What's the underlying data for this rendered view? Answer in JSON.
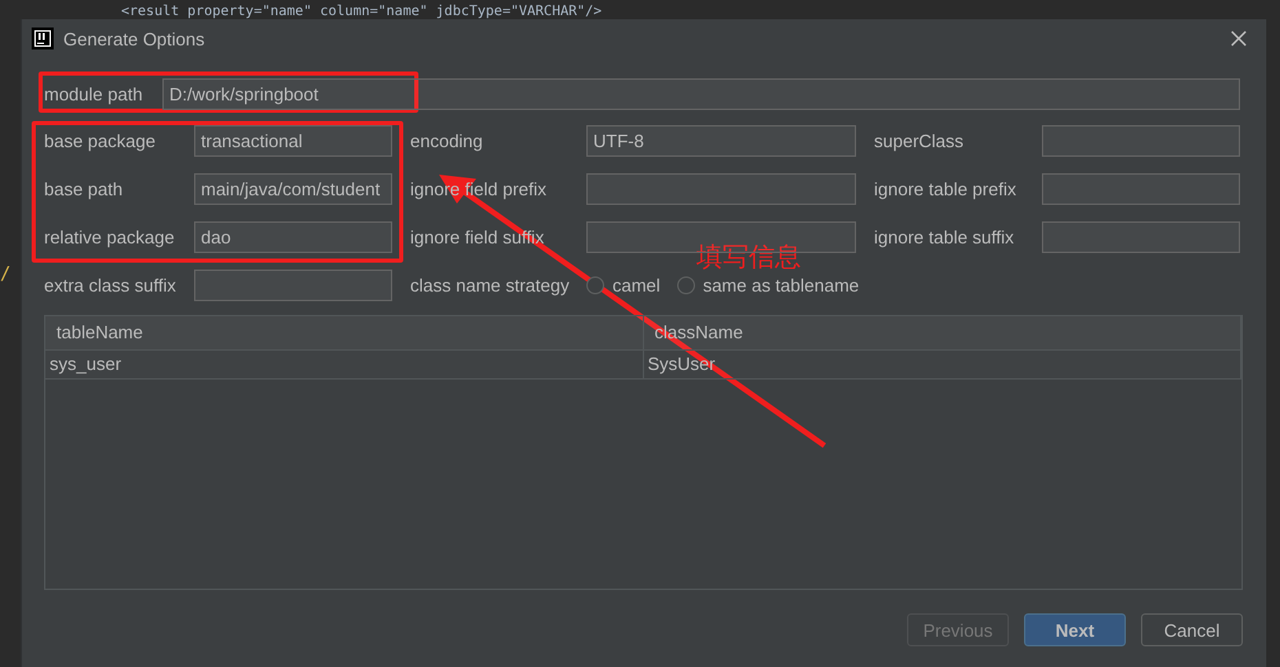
{
  "background_editor": {
    "code_line": "<result property=\"name\" column=\"name\" jdbcType=\"VARCHAR\"/>",
    "gutter_text": "/"
  },
  "window": {
    "title": "Generate Options"
  },
  "module_path": {
    "label": "module path",
    "value": "D:/work/springboot"
  },
  "fields": [
    [
      {
        "label": "base package",
        "value": "transactional"
      },
      {
        "label": "encoding",
        "value": "UTF-8"
      },
      {
        "label": "superClass"
      }
    ],
    [
      {
        "label": "base path",
        "value": "main/java/com/student"
      },
      {
        "label": "ignore field prefix"
      },
      {
        "label": "ignore table prefix"
      }
    ],
    [
      {
        "label": "relative package",
        "value": "dao"
      },
      {
        "label": "ignore field suffix"
      },
      {
        "label": "ignore table suffix"
      }
    ]
  ],
  "extra_class_suffix": {
    "label": "extra class suffix"
  },
  "class_name_strategy": {
    "label": "class name strategy",
    "options": [
      {
        "label": "camel",
        "selected": false
      },
      {
        "label": "same as tablename",
        "selected": false
      }
    ]
  },
  "table": {
    "columns": [
      "tableName",
      "className"
    ],
    "rows": [
      [
        "sys_user",
        "SysUser"
      ]
    ]
  },
  "buttons": [
    {
      "label": "Previous",
      "disabled": true,
      "default": false
    },
    {
      "label": "Next",
      "disabled": false,
      "default": true
    },
    {
      "label": "Cancel",
      "disabled": false,
      "default": false
    }
  ],
  "annotation": {
    "text": "填写信息"
  }
}
